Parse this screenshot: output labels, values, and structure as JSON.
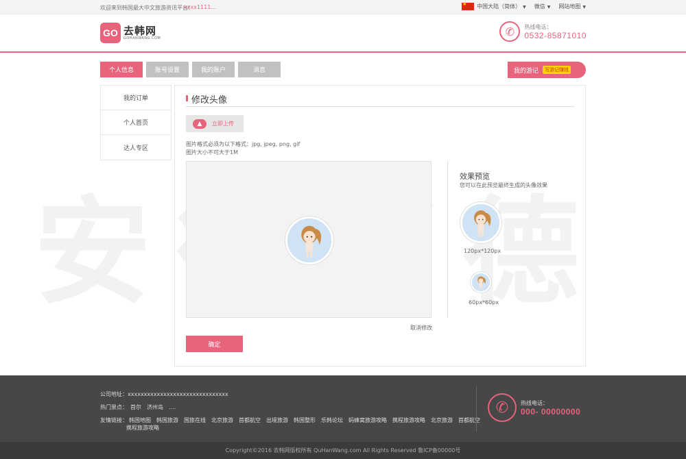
{
  "topbar": {
    "welcome": "欢迎来到韩国最大中文旅游资讯平台!",
    "user": "xxxx1111...",
    "region": "中国大陆（简体）",
    "wechat": "微信",
    "sitemap": "网站地图"
  },
  "header": {
    "logo_mark": "GO",
    "logo_cn": "去韩网",
    "logo_en": "GOHANWANG.COM",
    "hotline_label": "热线电话：",
    "hotline_number": "0532-85871010"
  },
  "tabs": [
    {
      "label": "个人信息"
    },
    {
      "label": "账号设置"
    },
    {
      "label": "我的账户"
    },
    {
      "label": "消息"
    }
  ],
  "travel": {
    "label": "我的游记",
    "tag": "写游记赚钱"
  },
  "sidebar": {
    "items": [
      {
        "label": "我的订单",
        "arrow": "›"
      },
      {
        "label": "个人首页"
      },
      {
        "label": "达人专区"
      }
    ]
  },
  "main": {
    "title": "修改头像",
    "upload_label": "立即上传",
    "format_hint": "图片格式必须为以下格式：jpg, jpeg, png, gif",
    "size_hint": "图片大小不可大于1M",
    "cancel": "取消修改",
    "confirm": "确定",
    "preview_title": "效果预览",
    "preview_sub": "您可以在此预览最终生成的头像效果",
    "size_large": "120px*120px",
    "size_small": "60px*60px",
    "watermark": "安徽邦德"
  },
  "footer": {
    "address_label": "公司地址：",
    "address_value": "xxxxxxxxxxxxxxxxxxxxxxxxxxxxxxx",
    "hot_label": "热门景点：",
    "hot_items": [
      "首尔",
      "济州岛",
      "...."
    ],
    "links_label": "友情链接：",
    "links": [
      "韩国地图",
      "韩国旅游",
      "国旅在线",
      "北京旅游",
      "首都航空",
      "出境旅游",
      "韩国整形",
      "乐韩论坛",
      "蚂蜂窝旅游攻略",
      "携程旅游攻略",
      "北京旅游",
      "首都航空"
    ],
    "links_row2": "携程旅游攻略",
    "hotline_label": "热线电话：",
    "hotline_number": "000- 00000000",
    "copyright": "Copyright©2016 去韩网版权所有 QuHanWang.com All Rights Reserved 鲁ICP备00000号"
  },
  "colors": {
    "accent": "#e8637c",
    "tab_inactive": "#c1c1c1",
    "footer_bg": "#474747"
  }
}
